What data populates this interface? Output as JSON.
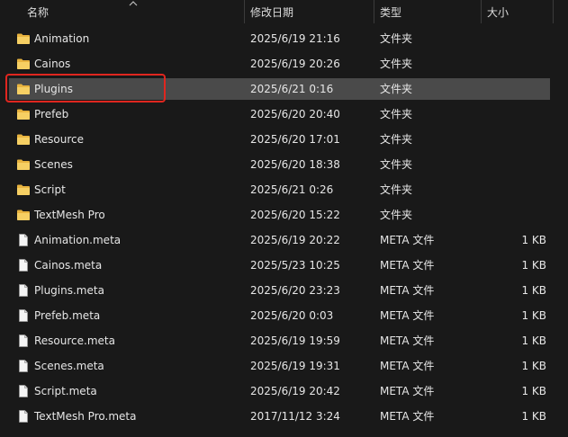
{
  "columns": {
    "name": "名称",
    "modified": "修改日期",
    "type": "类型",
    "size": "大小"
  },
  "colors": {
    "background": "#191919",
    "selected_row": "#4a4a4a",
    "folder_icon": "#f3c75a",
    "highlight_border": "#e0261f"
  },
  "files": [
    {
      "name": "Animation",
      "modified": "2025/6/19 21:16",
      "type": "文件夹",
      "size": "",
      "icon": "folder-icon"
    },
    {
      "name": "Cainos",
      "modified": "2025/6/19 20:26",
      "type": "文件夹",
      "size": "",
      "icon": "folder-icon"
    },
    {
      "name": "Plugins",
      "modified": "2025/6/21 0:16",
      "type": "文件夹",
      "size": "",
      "icon": "folder-icon",
      "selected": true
    },
    {
      "name": "Prefeb",
      "modified": "2025/6/20 20:40",
      "type": "文件夹",
      "size": "",
      "icon": "folder-icon"
    },
    {
      "name": "Resource",
      "modified": "2025/6/20 17:01",
      "type": "文件夹",
      "size": "",
      "icon": "folder-icon"
    },
    {
      "name": "Scenes",
      "modified": "2025/6/20 18:38",
      "type": "文件夹",
      "size": "",
      "icon": "folder-icon"
    },
    {
      "name": "Script",
      "modified": "2025/6/21 0:26",
      "type": "文件夹",
      "size": "",
      "icon": "folder-icon"
    },
    {
      "name": "TextMesh Pro",
      "modified": "2025/6/20 15:22",
      "type": "文件夹",
      "size": "",
      "icon": "folder-icon"
    },
    {
      "name": "Animation.meta",
      "modified": "2025/6/19 20:22",
      "type": "META 文件",
      "size": "1 KB",
      "icon": "file-icon"
    },
    {
      "name": "Cainos.meta",
      "modified": "2025/5/23 10:25",
      "type": "META 文件",
      "size": "1 KB",
      "icon": "file-icon"
    },
    {
      "name": "Plugins.meta",
      "modified": "2025/6/20 23:23",
      "type": "META 文件",
      "size": "1 KB",
      "icon": "file-icon"
    },
    {
      "name": "Prefeb.meta",
      "modified": "2025/6/20 0:03",
      "type": "META 文件",
      "size": "1 KB",
      "icon": "file-icon"
    },
    {
      "name": "Resource.meta",
      "modified": "2025/6/19 19:59",
      "type": "META 文件",
      "size": "1 KB",
      "icon": "file-icon"
    },
    {
      "name": "Scenes.meta",
      "modified": "2025/6/19 19:31",
      "type": "META 文件",
      "size": "1 KB",
      "icon": "file-icon"
    },
    {
      "name": "Script.meta",
      "modified": "2025/6/19 20:42",
      "type": "META 文件",
      "size": "1 KB",
      "icon": "file-icon"
    },
    {
      "name": "TextMesh Pro.meta",
      "modified": "2017/11/12 3:24",
      "type": "META 文件",
      "size": "1 KB",
      "icon": "file-icon"
    }
  ]
}
